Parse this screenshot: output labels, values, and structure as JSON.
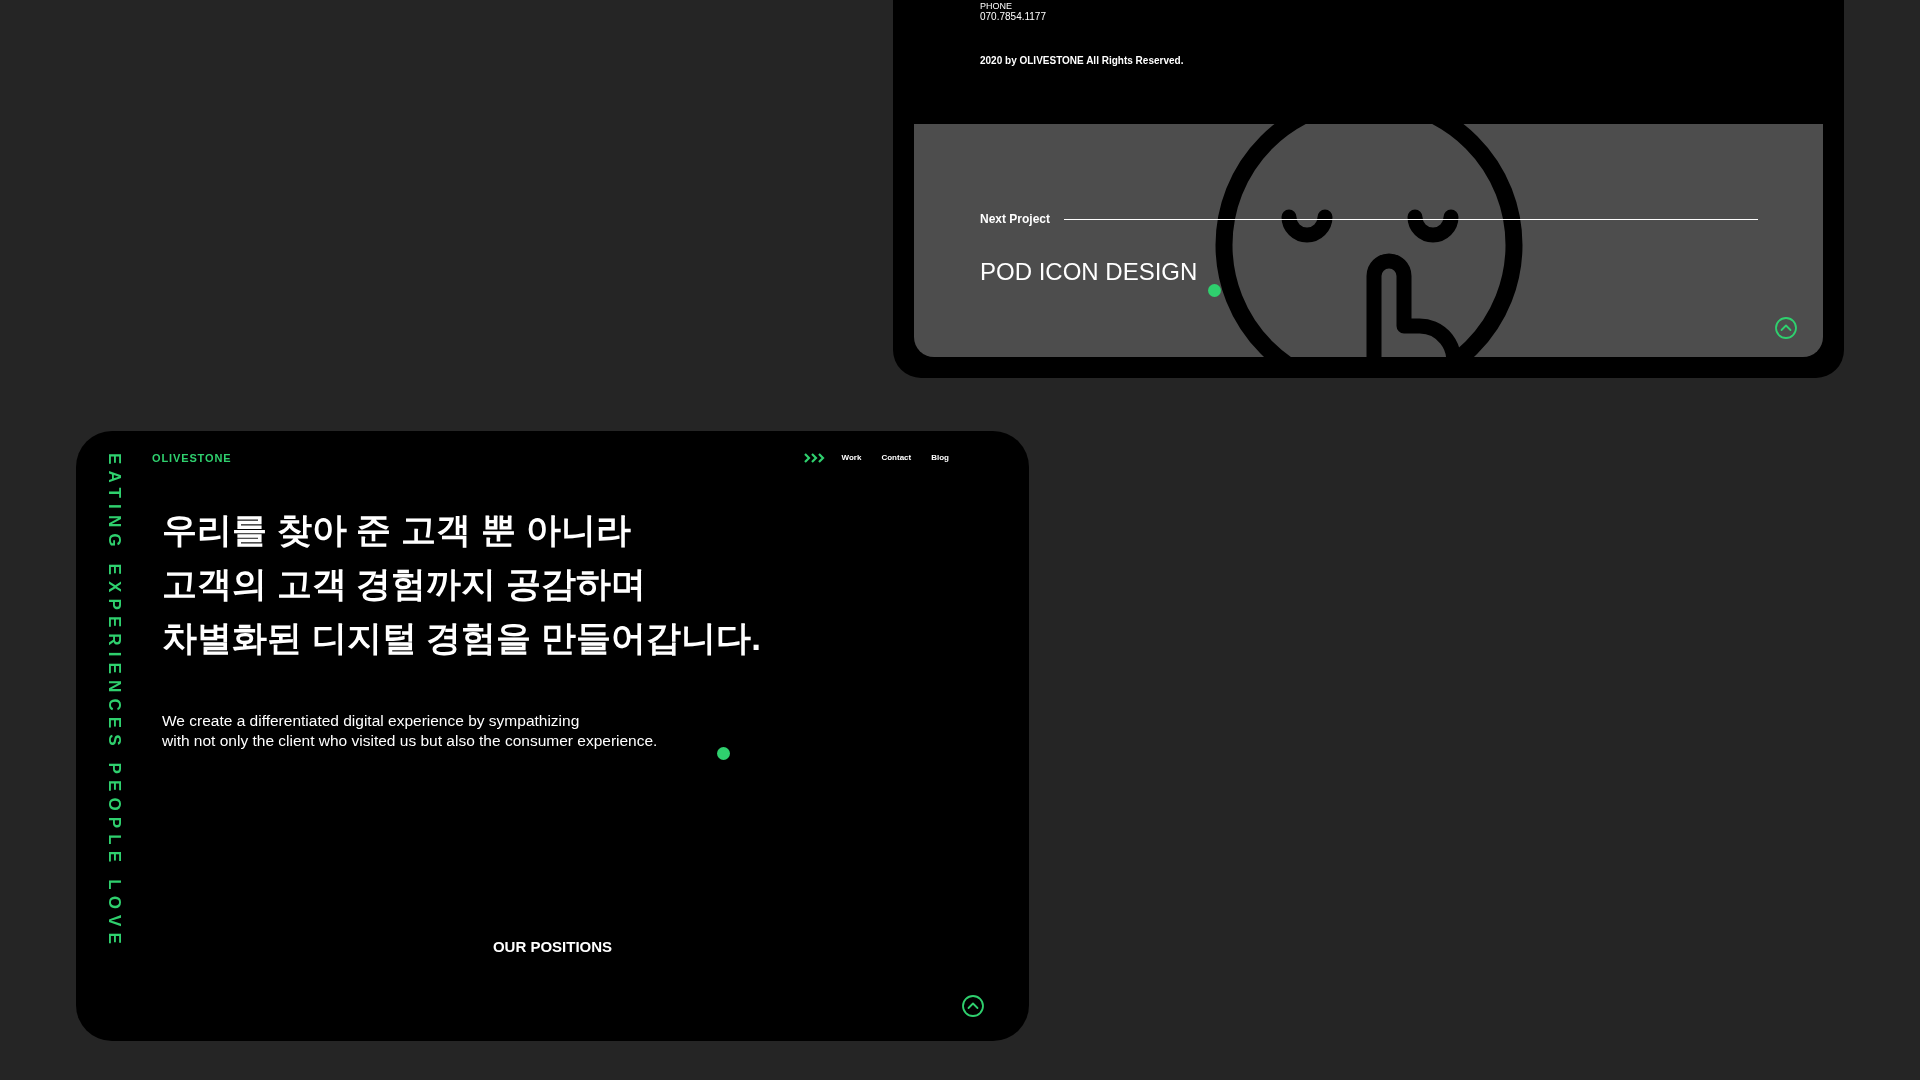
{
  "footer": {
    "phone_label": "PHONE",
    "phone": "070.7854.1177",
    "copyright": "2020 by OLIVESTONE All Rights Reserved."
  },
  "next_project": {
    "label": "Next Project",
    "title": "POD ICON DESIGN"
  },
  "site": {
    "logo": "OLIVESTONE",
    "nav": [
      {
        "label": "Work"
      },
      {
        "label": "Contact"
      },
      {
        "label": "Blog"
      }
    ],
    "side_text": "EATING EXPERIENCES PEOPLE LOVE",
    "headline": [
      "우리를 찾아 준 고객 뿐 아니라",
      "고객의 고객 경험까지 공감하며",
      "차별화된 디지털 경험을 만들어갑니다."
    ],
    "intro": [
      "We create a differentiated digital experience by sympathizing",
      "with not only the client who visited us but also the consumer experience."
    ],
    "section_title": "OUR POSITIONS"
  }
}
